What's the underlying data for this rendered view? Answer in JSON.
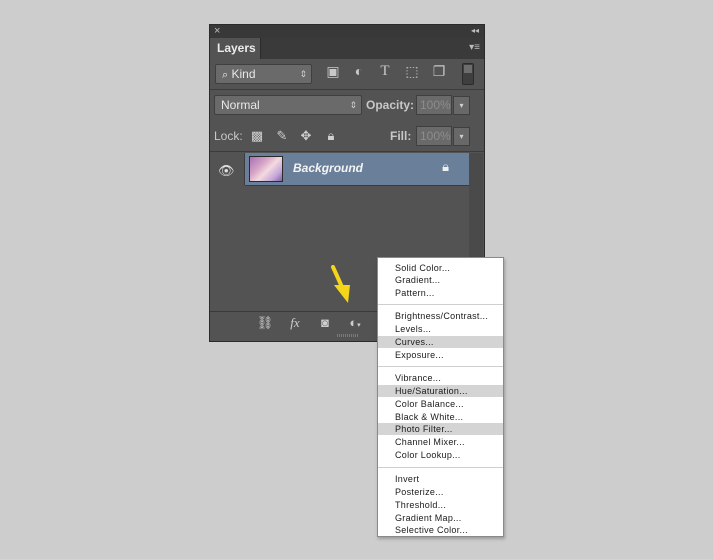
{
  "panel": {
    "title": "Layers",
    "close_glyph": "×",
    "collapse_glyph": "◂◂",
    "menu_glyph": "▾≡",
    "filter_kind": "Kind",
    "blend_mode": "Normal",
    "opacity_label": "Opacity:",
    "opacity_value": "100%",
    "lock_label": "Lock:",
    "fill_label": "Fill:",
    "fill_value": "100%",
    "layer_name": "Background"
  },
  "icons": {
    "eye": "visibility-eye-icon",
    "filter": [
      "image-filter-icon",
      "adjustment-filter-icon",
      "type-filter-icon",
      "shape-filter-icon",
      "smart-object-filter-icon"
    ],
    "lock": [
      "lock-transparent-icon",
      "lock-image-icon",
      "lock-position-icon",
      "lock-all-icon"
    ],
    "bottom": [
      "link-layers-icon",
      "fx-icon",
      "add-mask-icon",
      "new-adjustment-layer-icon"
    ]
  },
  "adjustment_menu": {
    "group1": [
      "Solid Color...",
      "Gradient...",
      "Pattern..."
    ],
    "group2": [
      "Brightness/Contrast...",
      "Levels...",
      "Curves...",
      "Exposure..."
    ],
    "group3": [
      "Vibrance...",
      "Hue/Saturation...",
      "Color Balance...",
      "Black & White...",
      "Photo Filter...",
      "Channel Mixer...",
      "Color Lookup..."
    ],
    "group4": [
      "Invert",
      "Posterize...",
      "Threshold...",
      "Gradient Map...",
      "Selective Color..."
    ],
    "highlighted": [
      "Curves...",
      "Hue/Saturation...",
      "Photo Filter..."
    ]
  },
  "colors": {
    "panel_bg": "#535353",
    "selected_layer": "#6a7f99",
    "pointer_arrow": "#f5d51a",
    "menu_highlight": "#d4d4d4"
  }
}
